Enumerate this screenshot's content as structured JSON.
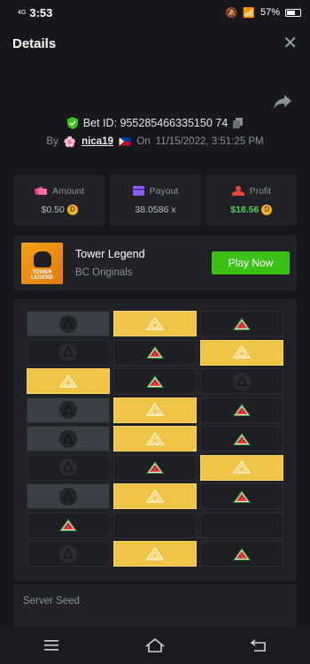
{
  "status_bar": {
    "network": "4G",
    "time": "3:53",
    "battery": "57%"
  },
  "header": {
    "title": "Details",
    "close_icon": "close-icon"
  },
  "bet": {
    "id_label": "Bet ID: 955285466335150 74",
    "by_label": "By",
    "username": "nica19",
    "on_label": "On",
    "datetime": "11/15/2022, 3:51:25 PM"
  },
  "stats": {
    "amount": {
      "label": "Amount",
      "value": "$0.50"
    },
    "payout": {
      "label": "Payout",
      "value": "38.0586 x"
    },
    "profit": {
      "label": "Profit",
      "value": "$18.56"
    }
  },
  "game": {
    "name": "Tower Legend",
    "provider": "BC Originals",
    "play_label": "Play Now",
    "logo_text": "TOWER LEGEND"
  },
  "board": {
    "rows": [
      [
        "revealed-skull",
        "picked",
        "melon"
      ],
      [
        "dim-skull",
        "melon",
        "picked"
      ],
      [
        "picked",
        "melon",
        "dim-skull"
      ],
      [
        "revealed-skull",
        "picked",
        "melon"
      ],
      [
        "revealed-skull",
        "picked",
        "melon"
      ],
      [
        "dim-skull",
        "melon",
        "picked"
      ],
      [
        "revealed-skull",
        "picked",
        "melon"
      ],
      [
        "melon",
        "dim",
        "dim"
      ],
      [
        "dim-skull",
        "picked",
        "melon"
      ]
    ]
  },
  "seed": {
    "label": "Server Seed"
  },
  "colors": {
    "accent": "#3bc117",
    "picked": "#efc548",
    "profit": "#4fd35d",
    "coin": "#f2b521"
  }
}
